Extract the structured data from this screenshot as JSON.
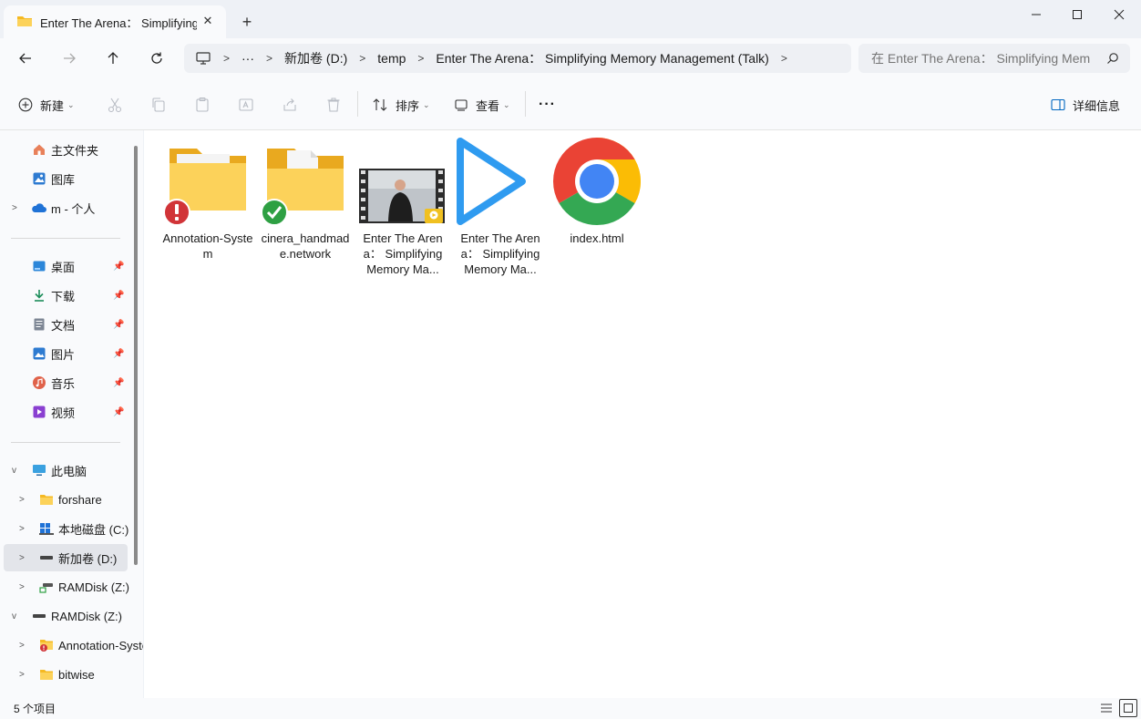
{
  "window": {
    "tab_title": "Enter The Arena： Simplifying",
    "new_tab_symbol": "+",
    "close_symbol": "✕"
  },
  "breadcrumbs": [
    "···",
    "新加卷 (D:)",
    "temp",
    "Enter The Arena： Simplifying Memory Management (Talk)"
  ],
  "search": {
    "placeholder": "在 Enter The Arena： Simplifying Mem"
  },
  "toolbar": {
    "new_label": "新建",
    "sort_label": "排序",
    "view_label": "查看",
    "more_label": "···",
    "details_label": "详细信息"
  },
  "sidebar": {
    "quick": [
      {
        "label": "主文件夹",
        "icon": "home-icon"
      },
      {
        "label": "图库",
        "icon": "gallery-icon"
      },
      {
        "label": "m - 个人",
        "icon": "onedrive-cloud-icon"
      }
    ],
    "pinned": [
      {
        "label": "桌面",
        "icon": "desktop-icon"
      },
      {
        "label": "下载",
        "icon": "download-icon"
      },
      {
        "label": "文档",
        "icon": "document-icon"
      },
      {
        "label": "图片",
        "icon": "pictures-icon"
      },
      {
        "label": "音乐",
        "icon": "music-icon"
      },
      {
        "label": "视频",
        "icon": "video-icon"
      }
    ],
    "tree": [
      {
        "label": "此电脑",
        "icon": "computer-icon"
      },
      {
        "label": "forshare",
        "icon": "folder-icon"
      },
      {
        "label": "本地磁盘 (C:)",
        "icon": "windows-drive-icon"
      },
      {
        "label": "新加卷 (D:)",
        "icon": "drive-icon"
      },
      {
        "label": "RAMDisk (Z:)",
        "icon": "network-drive-icon"
      },
      {
        "label": "RAMDisk (Z:)",
        "icon": "drive-icon"
      },
      {
        "label": "Annotation-System",
        "icon": "folder-error-icon"
      },
      {
        "label": "bitwise",
        "icon": "folder-icon"
      }
    ]
  },
  "files": [
    {
      "name": "Annotation-System",
      "icon": "folder-error-icon"
    },
    {
      "name": "cinera_handmade.network",
      "icon": "folder-synced-icon"
    },
    {
      "name": "Enter The Arena： Simplifying Memory Ma...",
      "icon": "video-thumbnail-icon"
    },
    {
      "name": "Enter The Arena： Simplifying Memory Ma...",
      "icon": "play-icon"
    },
    {
      "name": "index.html",
      "icon": "chrome-icon"
    }
  ],
  "status": {
    "item_count": "5 个项目"
  },
  "colors": {
    "accent": "#0067c0",
    "folder": "#f5c342",
    "error": "#d13438",
    "success": "#2ea043",
    "play": "#2f9bf0"
  }
}
